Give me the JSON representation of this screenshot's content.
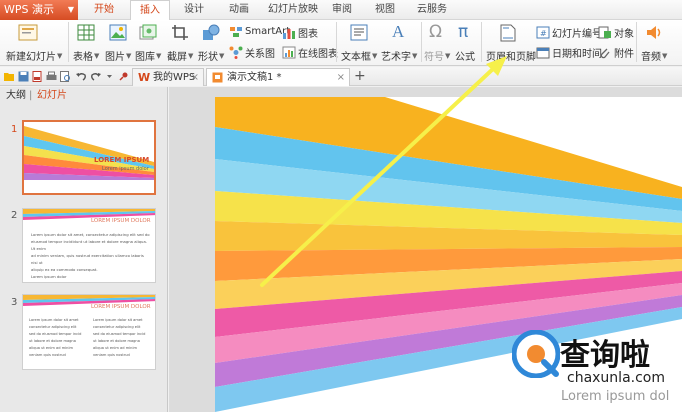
{
  "app": {
    "title": "WPS 演示"
  },
  "menu": {
    "tabs": [
      "开始",
      "插入",
      "设计",
      "动画",
      "幻灯片放映",
      "审阅",
      "视图",
      "云服务"
    ],
    "active_index": 1
  },
  "ribbon": {
    "new_slide": "新建幻灯片",
    "table": "表格",
    "picture": "图片",
    "gallery": "图库",
    "screenshot": "截屏",
    "shape": "形状",
    "smartart": "SmartArt",
    "relation": "关系图",
    "chart": "图表",
    "online_chart": "在线图表",
    "textbox": "文本框",
    "wordart": "艺术字",
    "symbol": "符号",
    "formula": "公式",
    "header_footer": "页眉和页脚",
    "slide_number": "幻灯片编号",
    "object": "对象",
    "datetime": "日期和时间",
    "attachment": "附件",
    "audio": "音频"
  },
  "tabs": {
    "wps_home": "我的WPS",
    "document": "演示文稿1 *",
    "new_tab": "+"
  },
  "panel": {
    "outline": "大纲",
    "slides": "幻灯片"
  },
  "slides": [
    {
      "number": "1",
      "title": "LOREM IPSUM",
      "subtitle": "Lorem ipsum dolor"
    },
    {
      "number": "2",
      "title": "LOREM IPSUM DOLOR",
      "body": [
        "Lorem ipsum dolor sit amet, consectetur adipiscing elit sed do",
        "eiusmod tempor incididunt ut labore et dolore magna aliqua. Ut enim",
        "ad minim veniam, quis nostrud exercitation ullamco laboris nisi ut",
        "aliquip ex ea commodo consequat.",
        "Lorem ipsum dolor"
      ]
    },
    {
      "number": "3",
      "title": "LOREM IPSUM DOLOR",
      "col1": [
        "Lorem ipsum dolor sit amet",
        "consectetur adipiscing elit",
        "sed do eiusmod tempor incid",
        "ut labore et dolore magna",
        "aliqua ut enim ad minim",
        "veniam quis nostrud"
      ],
      "col2": [
        "Lorem ipsum dolor sit amet",
        "consectetur adipiscing elit",
        "sed do eiusmod tempor incid",
        "ut labore et dolore magna",
        "aliqua ut enim ad minim",
        "veniam quis nostrud"
      ]
    }
  ],
  "canvas": {
    "caption": "Lorem ipsum dol"
  },
  "watermark": {
    "brand": "查询啦",
    "url": "chaxunla.com"
  },
  "colors": {
    "accent": "#d4471a",
    "arrow": "#f6f04a",
    "title_red": "#d8492a"
  }
}
